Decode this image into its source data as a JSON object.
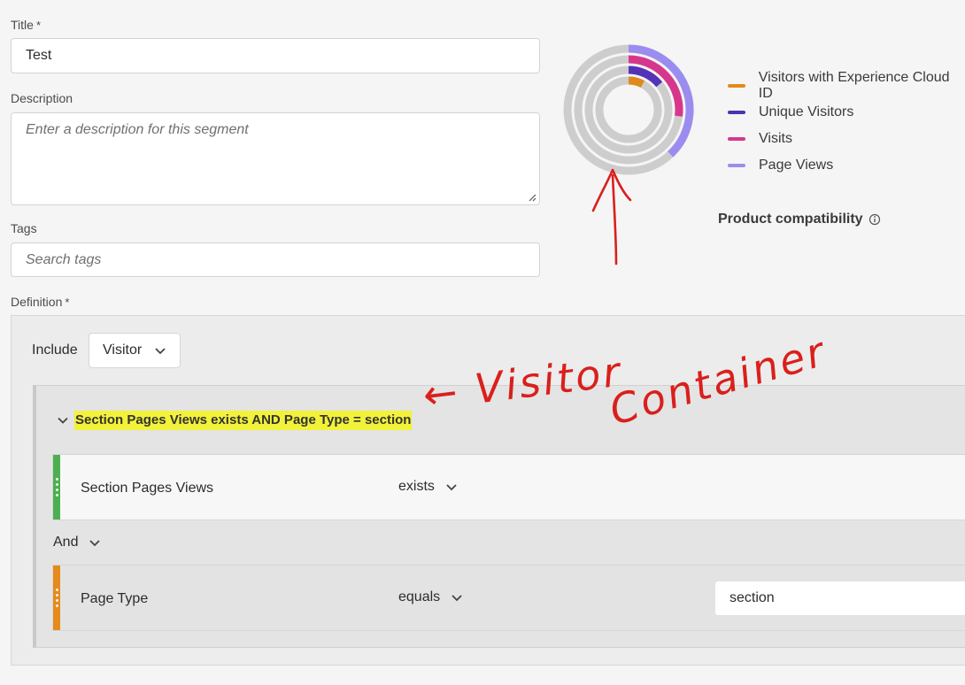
{
  "form": {
    "title_label": "Title",
    "title_required": "*",
    "title_value": "Test",
    "description_label": "Description",
    "description_placeholder": "Enter a description for this segment",
    "tags_label": "Tags",
    "tags_placeholder": "Search tags",
    "definition_label": "Definition",
    "definition_required": "*"
  },
  "chart_data": {
    "type": "pie",
    "rings": [
      {
        "name": "Page Views",
        "fraction": 0.38,
        "color": "#9b8cf0"
      },
      {
        "name": "Visits",
        "fraction": 0.27,
        "color": "#d6378c"
      },
      {
        "name": "Unique Visitors",
        "fraction": 0.14,
        "color": "#5433b8"
      },
      {
        "name": "Visitors with Experience Cloud ID",
        "fraction": 0.08,
        "color": "#e08a1e"
      }
    ],
    "track_color": "#cdcdcd",
    "legend_placement": "right"
  },
  "legend": [
    {
      "label": "Visitors with Experience Cloud ID",
      "color": "#e08a1e"
    },
    {
      "label": "Unique Visitors",
      "color": "#4a34b0"
    },
    {
      "label": "Visits",
      "color": "#d6378c"
    },
    {
      "label": "Page Views",
      "color": "#9b8cf0"
    }
  ],
  "compatibility": {
    "label": "Product compatibility",
    "info_icon": "info-icon"
  },
  "definition": {
    "include_label": "Include",
    "scope_value": "Visitor",
    "container_summary": "Section Pages Views exists AND Page Type = section",
    "rule1": {
      "dimension": "Section Pages Views",
      "operator": "exists",
      "color": "#4caf50"
    },
    "conjunction": "And",
    "rule2": {
      "dimension": "Page Type",
      "operator": "equals",
      "value": "section",
      "color": "#e68a1c"
    }
  },
  "annotation": {
    "line1": "← Visitor",
    "line2": "Container",
    "color": "#d9201c",
    "highlight_color": "#f2f23a"
  }
}
